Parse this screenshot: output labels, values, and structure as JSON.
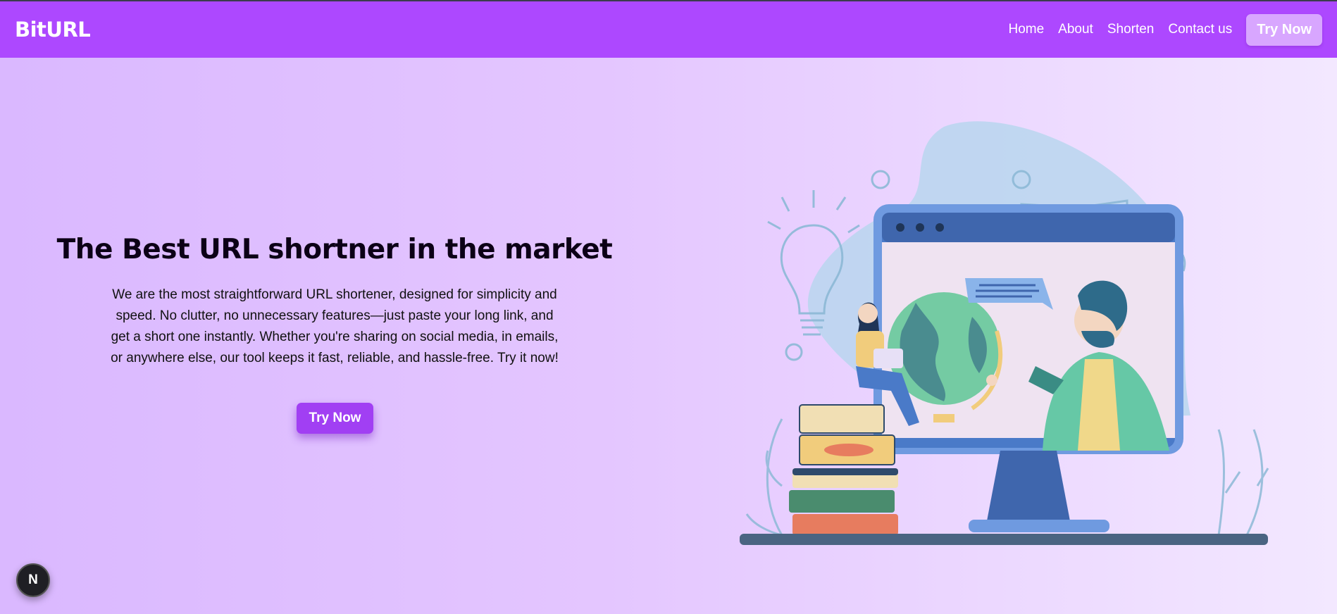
{
  "navbar": {
    "brand": "BitURL",
    "links": [
      "Home",
      "About",
      "Shorten",
      "Contact us"
    ],
    "cta_label": "Try Now"
  },
  "hero": {
    "title": "The Best URL shortner in the market",
    "description": "We are the most straightforward URL shortener, designed for simplicity and speed. No clutter, no unnecessary features—just paste your long link, and get a short one instantly. Whether you're sharing on social media, in emails, or anywhere else, our tool keeps it fast, reliable, and hassle-free. Try it now!",
    "cta_label": "Try Now"
  },
  "illustration": {
    "icon": "online-learning-illustration"
  },
  "dev_badge": {
    "label": "N",
    "icon": "nextjs-icon"
  },
  "colors": {
    "navbar_bg": "#ad48ff",
    "nav_cta_bg": "#d8a6ff",
    "hero_cta_bg": "#a13ff3",
    "page_gradient_start": "#dab8ff",
    "page_gradient_end": "#f3e8ff"
  }
}
